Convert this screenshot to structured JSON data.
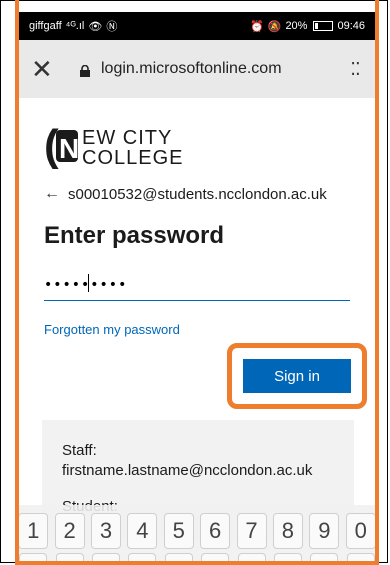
{
  "status_bar": {
    "carrier": "giffgaff",
    "signal": "⁴ᴳ.ıl",
    "battery": "20%",
    "time": "09:46"
  },
  "browser": {
    "url": "login.microsoftonline.com",
    "close_icon": "close-icon",
    "menu_icon": "more-icon"
  },
  "logo": {
    "line1": "EW CITY",
    "line2": "COLLEGE",
    "mark": "N"
  },
  "account": {
    "email": "s00010532@students.ncclondon.ac.uk"
  },
  "form": {
    "heading": "Enter password",
    "password_value": "•••••••••",
    "forgot_label": "Forgotten my password",
    "signin_label": "Sign in"
  },
  "info": {
    "staff_label": "Staff:",
    "staff_email": "firstname.lastname@ncclondon.ac.uk",
    "student_label": "Student:"
  },
  "keyboard": {
    "keys": [
      "1",
      "2",
      "3",
      "4",
      "5",
      "6",
      "7",
      "8",
      "9",
      "0"
    ]
  },
  "colors": {
    "accent": "#0067b8",
    "highlight": "#ee7d2e"
  }
}
